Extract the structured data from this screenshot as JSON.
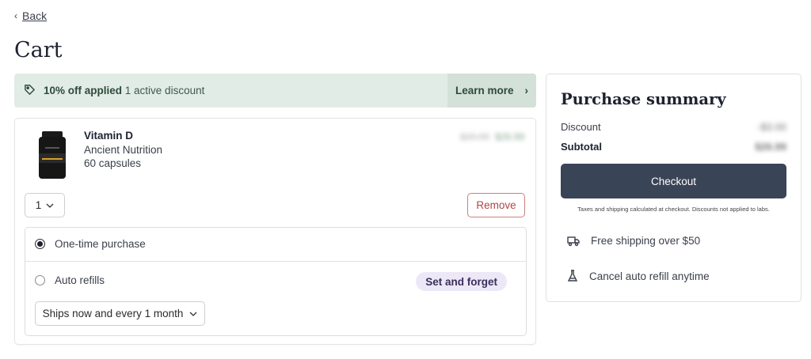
{
  "nav": {
    "back_label": "Back"
  },
  "page": {
    "title": "Cart"
  },
  "banner": {
    "discount_label": "10% off applied",
    "discount_sub": "1 active discount",
    "learn_more_label": "Learn more"
  },
  "item": {
    "name": "Vitamin D",
    "brand": "Ancient Nutrition",
    "size": "60 capsules",
    "price_original": "$29.99",
    "price_discounted": "$26.99",
    "quantity": "1",
    "remove_label": "Remove"
  },
  "purchase_options": {
    "one_time_label": "One-time purchase",
    "auto_refill_label": "Auto refills",
    "badge_label": "Set and forget",
    "frequency_selected": "Ships now and every 1 month",
    "selected": "one-time"
  },
  "summary": {
    "title": "Purchase summary",
    "discount_label": "Discount",
    "discount_value": "-$3.00",
    "subtotal_label": "Subtotal",
    "subtotal_value": "$26.99",
    "checkout_label": "Checkout",
    "note": "Taxes and shipping calculated at checkout. Discounts not applied to labs.",
    "features": [
      {
        "icon": "truck-icon",
        "label": "Free shipping over $50"
      },
      {
        "icon": "flask-icon",
        "label": "Cancel auto refill anytime"
      }
    ]
  },
  "colors": {
    "banner_bg": "#e2ece6",
    "checkout_bg": "#3a4457",
    "remove_border": "#c9807f",
    "badge_bg": "#ece8f7"
  }
}
